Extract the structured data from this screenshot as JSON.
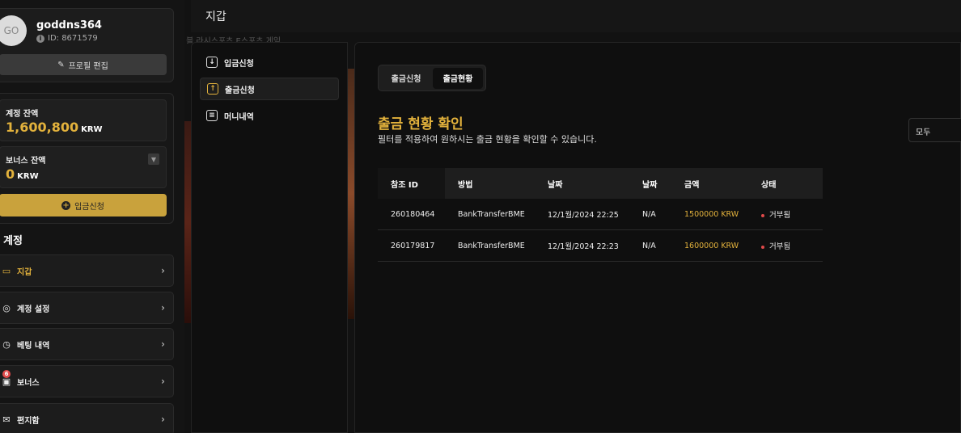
{
  "profile": {
    "avatar_initials": "GO",
    "username": "goddns364",
    "user_id": "ID: 8671579",
    "edit_label": "프로필 편집"
  },
  "balances": {
    "account_label": "계정 잔액",
    "account_value": "1,600,800",
    "account_unit": "KRW",
    "bonus_label": "보너스 잔액",
    "bonus_value": "0",
    "bonus_unit": "KRW",
    "deposit_label": "입금신청"
  },
  "account_menu": {
    "title": "계정",
    "items": [
      {
        "label": "지갑",
        "icon": "wallet-icon",
        "active": true
      },
      {
        "label": "계정 설정",
        "icon": "user-settings-icon"
      },
      {
        "label": "베팅 내역",
        "icon": "history-icon"
      },
      {
        "label": "보너스",
        "icon": "gift-icon",
        "badge": "6"
      },
      {
        "label": "편지함",
        "icon": "inbox-icon"
      }
    ]
  },
  "header": {
    "title": "지갑",
    "marquee": "블  라시스포츠  E스포츠  게임"
  },
  "wallet_tabs": [
    {
      "label": "입금신청",
      "icon": "download-icon"
    },
    {
      "label": "출금신청",
      "icon": "upload-icon",
      "active": true
    },
    {
      "label": "머니내역",
      "icon": "document-icon"
    }
  ],
  "segment": {
    "request_label": "출금신청",
    "status_label": "출금현황"
  },
  "main": {
    "heading": "출금 현황 확인",
    "subheading": "필터를 적용하여 원하시는 출금 현황을 확인할 수 있습니다.",
    "filter_value": "모두"
  },
  "table": {
    "headers": [
      "참조 ID",
      "방법",
      "날짜",
      "날짜",
      "금액",
      "상태"
    ],
    "rows": [
      [
        "260180464",
        "BankTransferBME",
        "12/1월/2024 22:25",
        "N/A",
        "1500000 KRW",
        "거부됨"
      ],
      [
        "260179817",
        "BankTransferBME",
        "12/1월/2024 22:23",
        "N/A",
        "1600000 KRW",
        "거부됨"
      ]
    ]
  },
  "colors": {
    "accent": "#e3b23c",
    "deposit_button": "#c9a23c",
    "status_rejected": "#e04a4a"
  }
}
